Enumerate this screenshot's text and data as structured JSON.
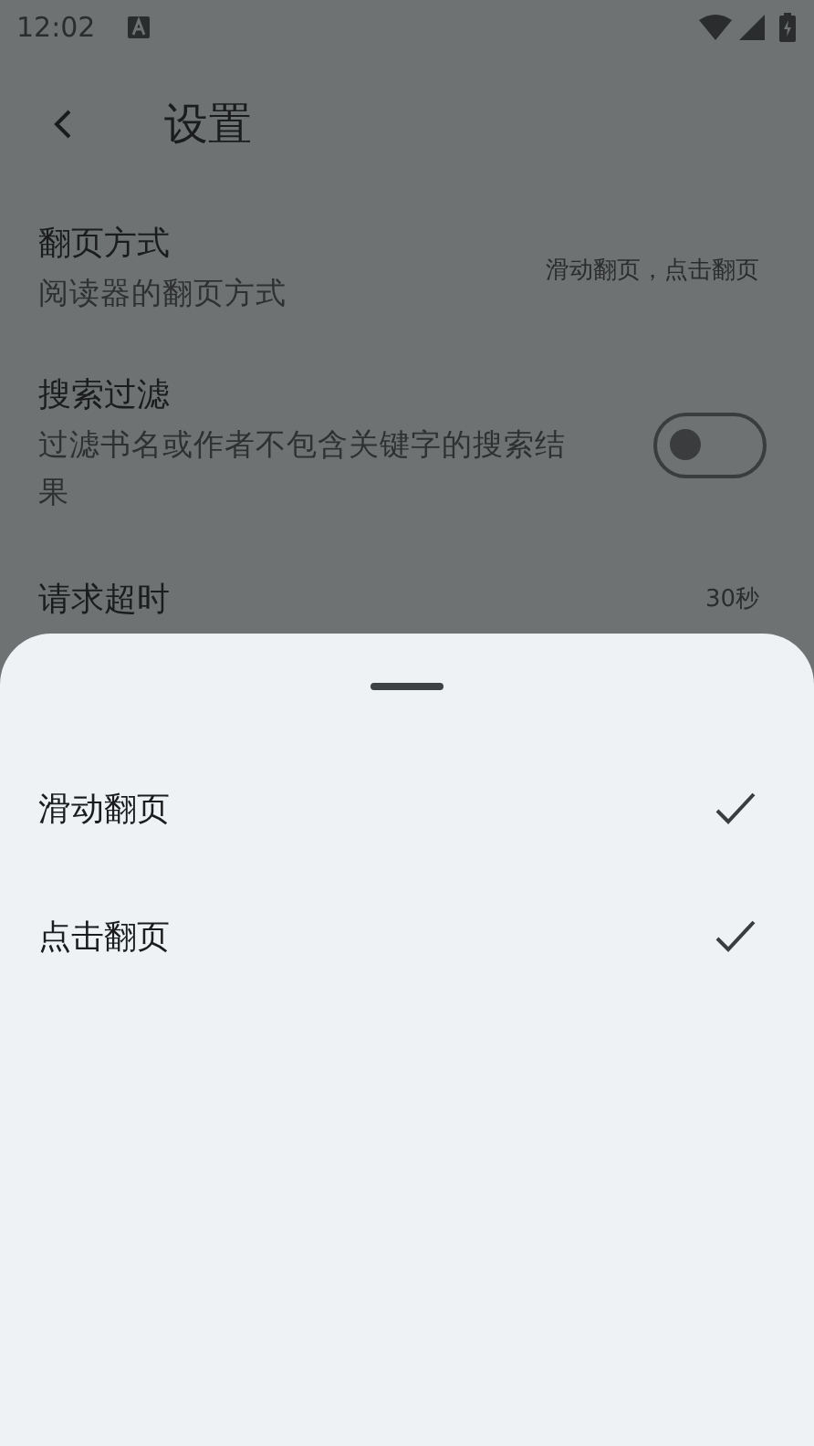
{
  "status_bar": {
    "time": "12:02"
  },
  "header": {
    "title": "设置"
  },
  "settings": [
    {
      "kind": "value",
      "title": "翻页方式",
      "subtitle": "阅读器的翻页方式",
      "value": "滑动翻页，点击翻页"
    },
    {
      "kind": "switch",
      "title": "搜索过滤",
      "subtitle": "过滤书名或作者不包含关键字的搜索结果",
      "on": false
    },
    {
      "kind": "value",
      "title": "请求超时",
      "value": "30秒"
    }
  ],
  "sheet": {
    "options": [
      {
        "label": "滑动翻页",
        "checked": true
      },
      {
        "label": "点击翻页",
        "checked": true
      }
    ]
  }
}
